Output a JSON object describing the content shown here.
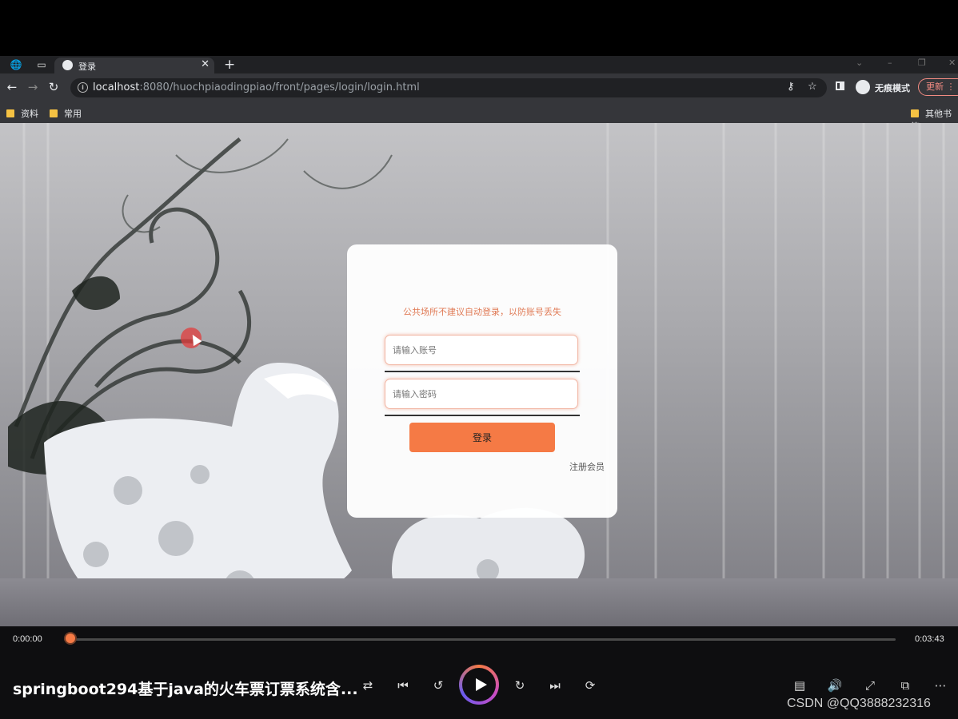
{
  "browser": {
    "tab_title": "登录",
    "url_host": "localhost",
    "url_path": ":8080/huochpiaodingpiao/front/pages/login/login.html",
    "incognito_label": "无痕模式",
    "update_label": "更新",
    "bookmarks": [
      "资料",
      "常用"
    ],
    "other_bookmarks": "其他书签"
  },
  "login": {
    "notice": "公共场所不建议自动登录，以防账号丢失",
    "account_placeholder": "请输入账号",
    "password_placeholder": "请输入密码",
    "login_button": "登录",
    "register_link": "注册会员"
  },
  "player": {
    "current_time": "0:00:00",
    "total_time": "0:03:43",
    "progress": 0.0,
    "title": "springboot294基于java的火车票订票系统含...",
    "watermark": "CSDN @QQ3888232316",
    "accent_color": "#f57a45"
  },
  "icons": {
    "back": "back-arrow-icon",
    "forward": "forward-arrow-icon",
    "reload": "reload-icon",
    "shuffle": "shuffle-icon",
    "previous": "skip-previous-icon",
    "rewind": "rewind-10-icon",
    "play": "play-icon",
    "forward30": "forward-30-icon",
    "next": "skip-next-icon",
    "loop": "loop-icon",
    "subtitles": "subtitles-icon",
    "volume": "volume-icon",
    "fullscreen": "fullscreen-icon",
    "pip": "picture-in-picture-icon",
    "more": "more-icon"
  }
}
